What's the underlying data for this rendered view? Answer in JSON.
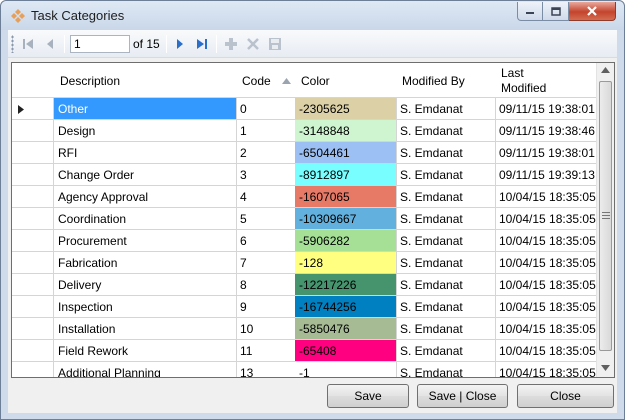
{
  "window": {
    "title": "Task Categories"
  },
  "toolbar": {
    "position": "1",
    "of_label": "of 15"
  },
  "grid": {
    "headers": {
      "description": "Description",
      "code": "Code",
      "color": "Color",
      "modified_by": "Modified By",
      "last_modified": "Last\nModified"
    },
    "rows": [
      {
        "description": "Other",
        "code": "0",
        "color": "-2305625",
        "swatch": "#dcd1a6",
        "modified_by": "S. Emdanat",
        "last_modified": "09/11/15 19:38:01",
        "selected": true
      },
      {
        "description": "Design",
        "code": "1",
        "color": "-3148848",
        "swatch": "#cff4d0",
        "modified_by": "S. Emdanat",
        "last_modified": "09/11/15 19:38:46"
      },
      {
        "description": "RFI",
        "code": "2",
        "color": "-6504461",
        "swatch": "#9cc0f3",
        "modified_by": "S. Emdanat",
        "last_modified": "09/11/15 19:38:01"
      },
      {
        "description": "Change Order",
        "code": "3",
        "color": "-8912897",
        "swatch": "#79feff",
        "modified_by": "S. Emdanat",
        "last_modified": "09/11/15 19:39:13"
      },
      {
        "description": "Agency Approval",
        "code": "4",
        "color": "-1607065",
        "swatch": "#e77a67",
        "modified_by": "S. Emdanat",
        "last_modified": "10/04/15 18:35:05"
      },
      {
        "description": "Coordination",
        "code": "5",
        "color": "-10309667",
        "swatch": "#62b0dd",
        "modified_by": "S. Emdanat",
        "last_modified": "10/04/15 18:35:05"
      },
      {
        "description": "Procurement",
        "code": "6",
        "color": "-5906282",
        "swatch": "#a5e096",
        "modified_by": "S. Emdanat",
        "last_modified": "10/04/15 18:35:05"
      },
      {
        "description": "Fabrication",
        "code": "7",
        "color": "-128",
        "swatch": "#ffff80",
        "modified_by": "S. Emdanat",
        "last_modified": "10/04/15 18:35:05"
      },
      {
        "description": "Delivery",
        "code": "8",
        "color": "-12217226",
        "swatch": "#45946e",
        "modified_by": "S. Emdanat",
        "last_modified": "10/04/15 18:35:05"
      },
      {
        "description": "Inspection",
        "code": "9",
        "color": "-16744256",
        "swatch": "#0080c0",
        "modified_by": "S. Emdanat",
        "last_modified": "10/04/15 18:35:05"
      },
      {
        "description": "Installation",
        "code": "10",
        "color": "-5850476",
        "swatch": "#a6bb94",
        "modified_by": "S. Emdanat",
        "last_modified": "10/04/15 18:35:05"
      },
      {
        "description": "Field Rework",
        "code": "11",
        "color": "-65408",
        "swatch": "#ff0080",
        "modified_by": "S. Emdanat",
        "last_modified": "10/04/15 18:35:05"
      },
      {
        "description": "Additional Planning",
        "code": "13",
        "color": "-1",
        "swatch": "#ffffff",
        "modified_by": "S. Emdanat",
        "last_modified": "10/04/15 18:35:05"
      }
    ]
  },
  "buttons": {
    "save": "Save",
    "save_close": "Save | Close",
    "close": "Close"
  }
}
